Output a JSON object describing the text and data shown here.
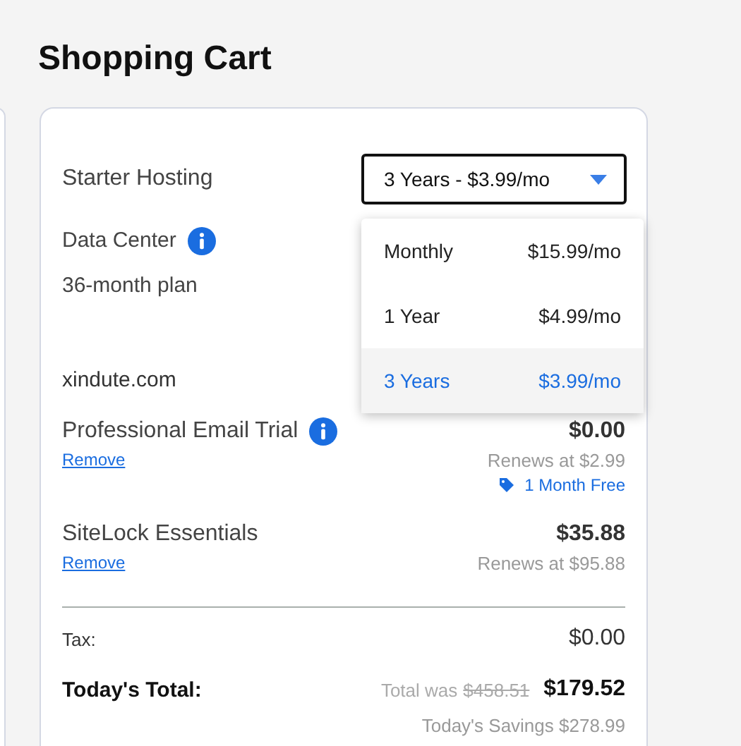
{
  "page_title": "Shopping Cart",
  "hosting": {
    "name": "Starter Hosting",
    "term": {
      "value": "3 Years - $3.99/mo",
      "options": [
        {
          "label": "Monthly",
          "price": "$15.99/mo",
          "selected": false
        },
        {
          "label": "1 Year",
          "price": "$4.99/mo",
          "selected": false
        },
        {
          "label": "3 Years",
          "price": "$3.99/mo",
          "selected": true
        }
      ]
    },
    "data_center": "Data Center",
    "plan": "36-month plan"
  },
  "domain": "xindute.com",
  "items": [
    {
      "name": "Professional Email Trial",
      "info": true,
      "remove": "Remove",
      "price": "$0.00",
      "renews": "Renews at $2.99",
      "promo": "1 Month Free"
    },
    {
      "name": "SiteLock Essentials",
      "info": false,
      "remove": "Remove",
      "price": "$35.88",
      "renews": "Renews at $95.88"
    }
  ],
  "tax": {
    "label": "Tax:",
    "value": "$0.00"
  },
  "total": {
    "label": "Today's Total:",
    "was_label": "Total was",
    "was_value": "$458.51",
    "value": "$179.52"
  },
  "savings": "Today's Savings $278.99"
}
